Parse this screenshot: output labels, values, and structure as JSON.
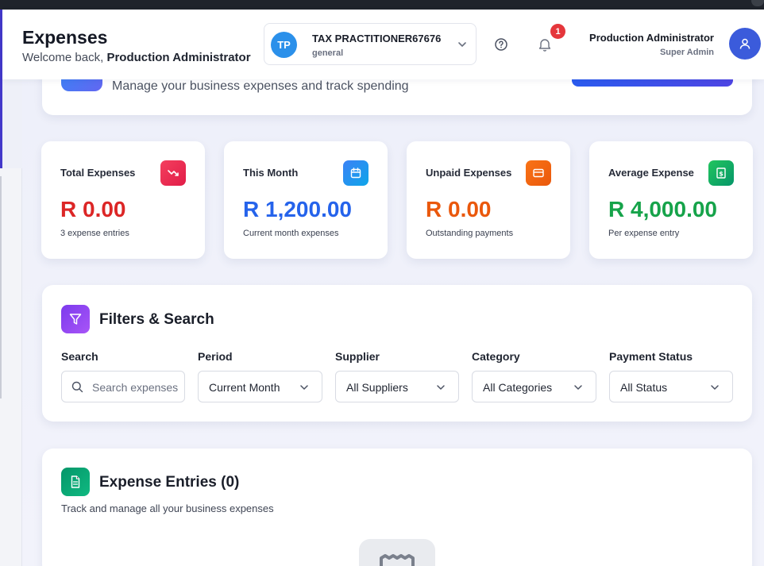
{
  "header": {
    "title": "Expenses",
    "welcome_prefix": "Welcome back, ",
    "welcome_user": "Production Administrator",
    "org": {
      "initials": "TP",
      "name": "TAX PRACTITIONER67676",
      "sub": "general"
    },
    "notification_count": "1",
    "user": {
      "name": "Production Administrator",
      "role": "Super Admin"
    }
  },
  "hero": {
    "subtitle": "Manage your business expenses and track spending"
  },
  "stats": [
    {
      "label": "Total Expenses",
      "value": "R 0.00",
      "note": "3 expense entries",
      "color": "#dc2626",
      "icon": "trending-down-icon"
    },
    {
      "label": "This Month",
      "value": "R 1,200.00",
      "note": "Current month expenses",
      "color": "#2563eb",
      "icon": "calendar-icon"
    },
    {
      "label": "Unpaid Expenses",
      "value": "R 0.00",
      "note": "Outstanding payments",
      "color": "#ea580c",
      "icon": "credit-card-icon"
    },
    {
      "label": "Average Expense",
      "value": "R 4,000.00",
      "note": "Per expense entry",
      "color": "#16a34a",
      "icon": "receipt-icon"
    }
  ],
  "filters": {
    "title": "Filters & Search",
    "search": {
      "label": "Search",
      "placeholder": "Search expenses"
    },
    "period": {
      "label": "Period",
      "value": "Current Month"
    },
    "supplier": {
      "label": "Supplier",
      "value": "All Suppliers"
    },
    "category": {
      "label": "Category",
      "value": "All Categories"
    },
    "payment_status": {
      "label": "Payment Status",
      "value": "All Status"
    }
  },
  "entries": {
    "title": "Expense Entries (0)",
    "subtitle": "Track and manage all your business expenses"
  }
}
